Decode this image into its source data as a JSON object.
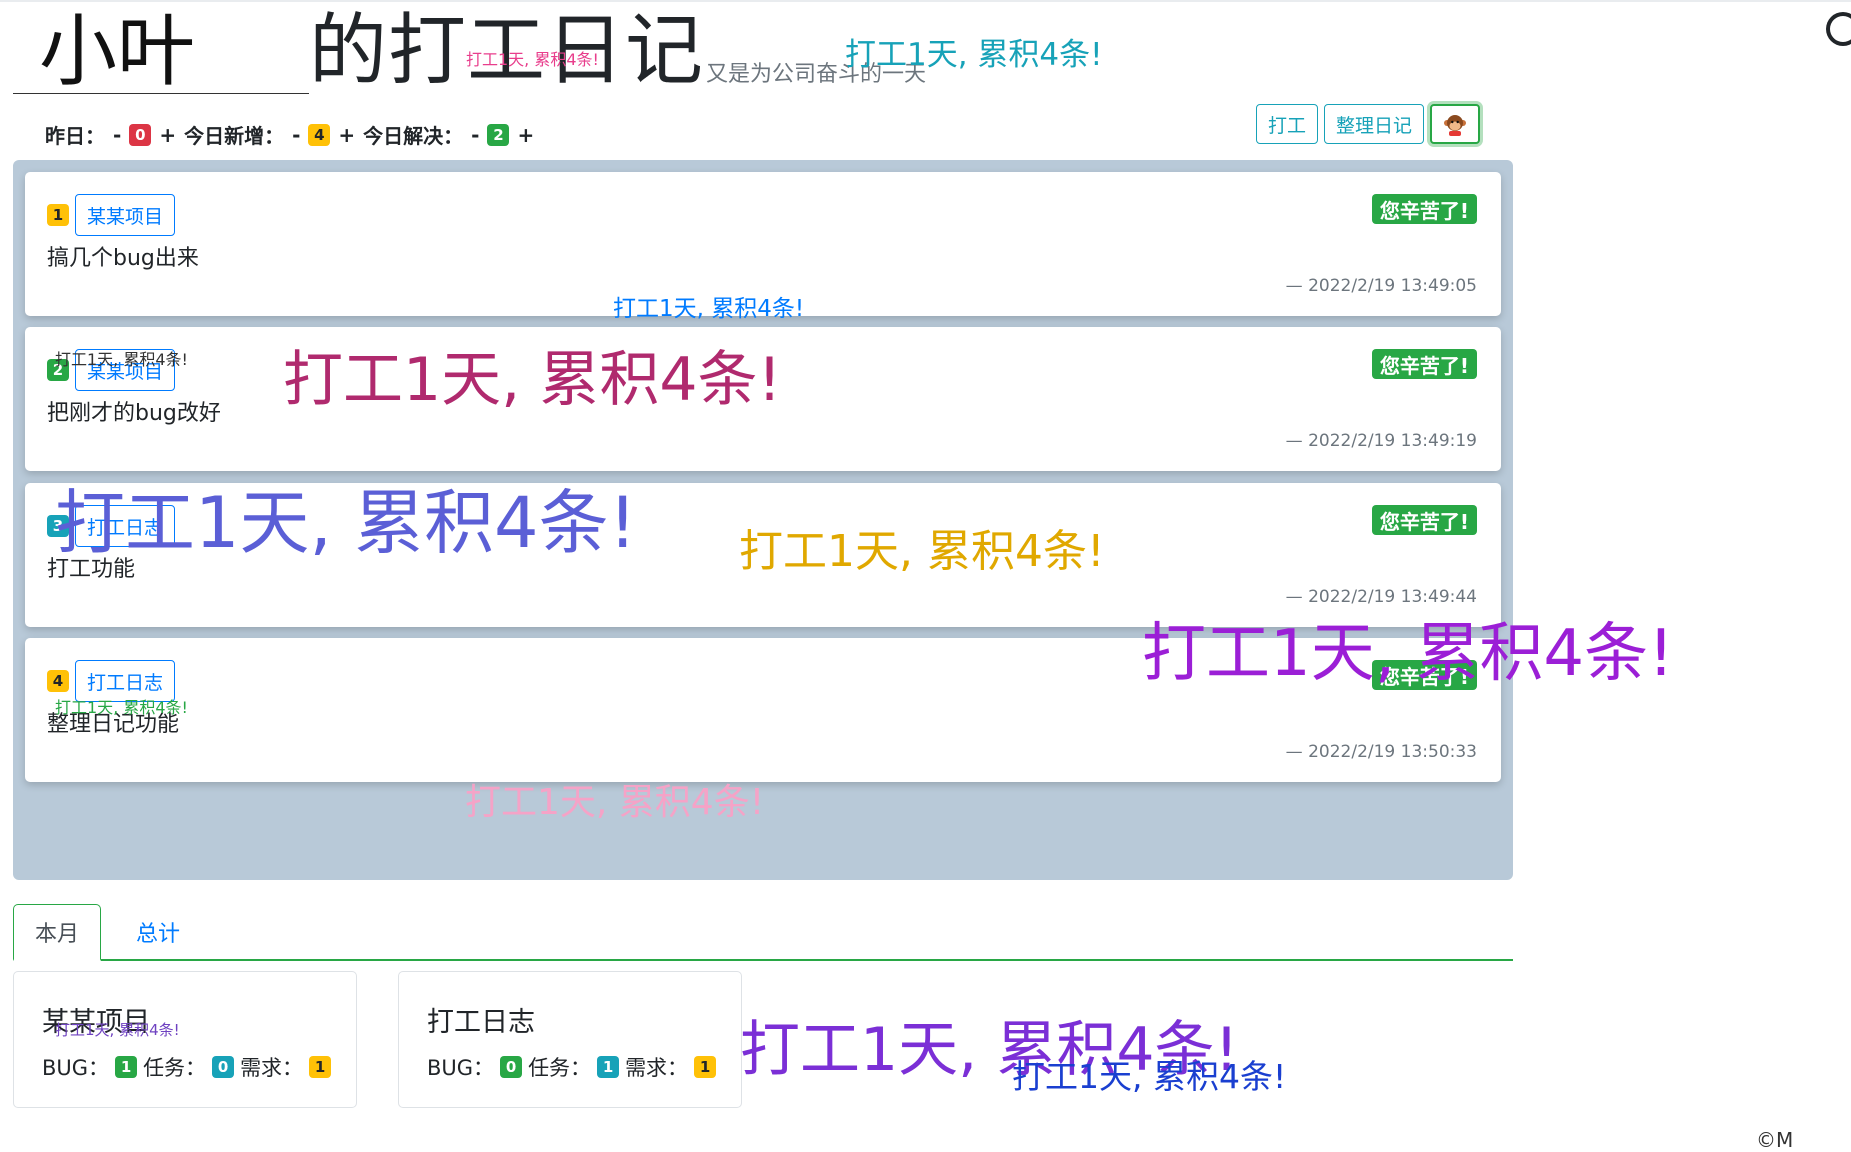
{
  "header": {
    "name_value": "小叶",
    "title_suffix": "的打工日记",
    "subtitle": "又是为公司奋斗的一天"
  },
  "stats": {
    "yesterday_label": "昨日：",
    "yesterday_count": "0",
    "today_new_label": "今日新增：",
    "today_new_count": "4",
    "today_solved_label": "今日解决：",
    "today_solved_count": "2",
    "minus": "-",
    "plus": "+"
  },
  "toolbar": {
    "work_label": "打工",
    "organize_label": "整理日记",
    "avatar_icon": "monkey-avatar-icon"
  },
  "cards": [
    {
      "number": "1",
      "number_color": "#ffc107",
      "project": "某某项目",
      "text": "搞几个bug出来",
      "done_label": "您辛苦了!",
      "time": "— 2022/2/19 13:49:05"
    },
    {
      "number": "2",
      "number_color": "#28a745",
      "project": "某某项目",
      "text": "把刚才的bug改好",
      "done_label": "您辛苦了!",
      "time": "— 2022/2/19 13:49:19"
    },
    {
      "number": "3",
      "number_color": "#17a2b8",
      "project": "打工日志",
      "text": "打工功能",
      "done_label": "您辛苦了!",
      "time": "— 2022/2/19 13:49:44"
    },
    {
      "number": "4",
      "number_color": "#ffc107",
      "project": "打工日志",
      "text": "整理日记功能",
      "done_label": "您辛苦了!",
      "time": "— 2022/2/19 13:50:33"
    }
  ],
  "tabs": {
    "month_label": "本月",
    "total_label": "总计"
  },
  "summary": [
    {
      "title": "某某项目",
      "bug_label": "BUG：",
      "bug_count": "1",
      "task_label": "任务：",
      "task_count": "0",
      "req_label": "需求：",
      "req_count": "1"
    },
    {
      "title": "打工日志",
      "bug_label": "BUG：",
      "bug_count": "0",
      "task_label": "任务：",
      "task_count": "1",
      "req_label": "需求：",
      "req_count": "1"
    }
  ],
  "floating_message": "打工1天, 累积4条!",
  "floating_colors": [
    "#e83e8c",
    "#17a2b8",
    "#007bff",
    "#333333",
    "#b02a6e",
    "#5b5fd6",
    "#e0a800",
    "#9b1fd6",
    "#28a745",
    "#f5a3c7",
    "#6f42c1",
    "#7b2fd6",
    "#1a3fd0"
  ],
  "corner_text": "©M"
}
